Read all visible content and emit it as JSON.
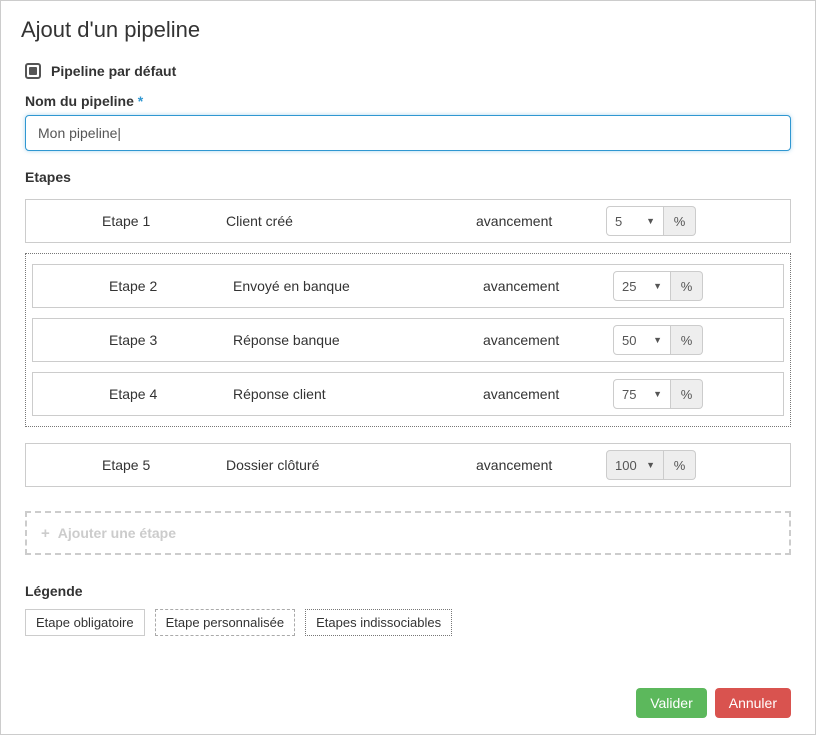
{
  "title": "Ajout d'un pipeline",
  "default_checkbox_label": "Pipeline par défaut",
  "name_label": "Nom du pipeline",
  "required_marker": "*",
  "name_value": "Mon pipeline|",
  "etapes_label": "Etapes",
  "avancement_label": "avancement",
  "pct_symbol": "%",
  "etapes": [
    {
      "num": "Etape 1",
      "name": "Client créé",
      "value": "5",
      "readonly": false
    },
    {
      "num": "Etape 2",
      "name": "Envoyé en banque",
      "value": "25",
      "readonly": false
    },
    {
      "num": "Etape 3",
      "name": "Réponse banque",
      "value": "50",
      "readonly": false
    },
    {
      "num": "Etape 4",
      "name": "Réponse client",
      "value": "75",
      "readonly": false
    },
    {
      "num": "Etape 5",
      "name": "Dossier clôturé",
      "value": "100",
      "readonly": true
    }
  ],
  "add_etape_label": "Ajouter une étape",
  "legend_label": "Légende",
  "legend": {
    "obligatoire": "Etape obligatoire",
    "personnalisee": "Etape personnalisée",
    "indissociables": "Etapes indissociables"
  },
  "buttons": {
    "valider": "Valider",
    "annuler": "Annuler"
  }
}
